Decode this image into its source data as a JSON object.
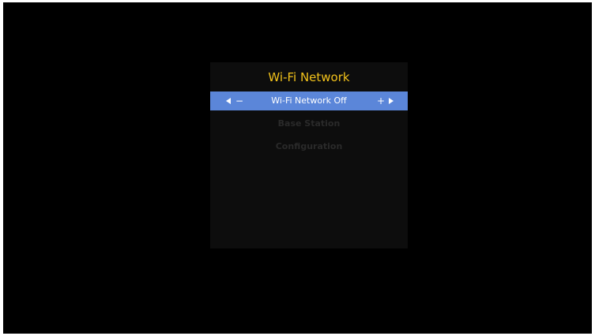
{
  "menu": {
    "title": "Wi-Fi Network",
    "items": [
      {
        "label": "Wi-Fi Network Off",
        "selected": true,
        "decrement_symbol": "−",
        "increment_symbol": "+"
      },
      {
        "label": "Base Station",
        "selected": false
      },
      {
        "label": "Configuration",
        "selected": false
      }
    ]
  },
  "colors": {
    "title": "#f2c21b",
    "highlight": "#5b86d9",
    "panel": "#0d0d0d",
    "screen": "#000000"
  }
}
